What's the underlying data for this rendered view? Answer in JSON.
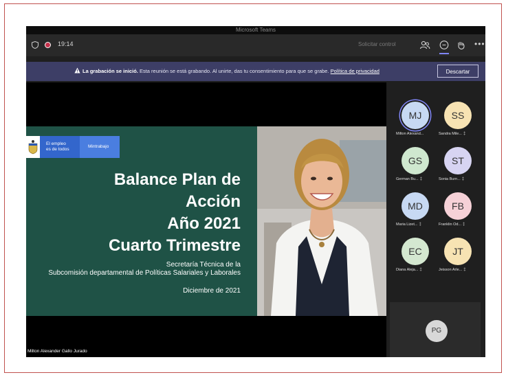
{
  "window": {
    "title": "Microsoft Teams"
  },
  "toolbar": {
    "time": "19:14",
    "request_control": "Solicitar control",
    "icons": [
      "shield-icon",
      "record-icon",
      "people-icon",
      "chat-icon",
      "reactions-icon",
      "more-icon"
    ],
    "more_label": "•••"
  },
  "banner": {
    "bold": "La grabación se inició.",
    "text": " Esta reunión se está grabando. Al unirte, das tu consentimiento para que se grabe. ",
    "link": "Política de privacidad",
    "dismiss": "Descartar"
  },
  "slide": {
    "logo_line1": "El empleo",
    "logo_line2": "es de todos",
    "logo_right": "Mintrabajo",
    "title_line1": "Balance Plan de",
    "title_line2": "Acción",
    "title_line3": "Año 2021",
    "title_line4": "Cuarto Trimestre",
    "sub_line1": "Secretaría Técnica de la",
    "sub_line2": "Subcomisión departamental de Políticas Salariales y Laborales",
    "date": "Diciembre de 2021"
  },
  "presenter": {
    "name": "Milton Alexander Gallo Jurado"
  },
  "participants": [
    {
      "initials": "MJ",
      "name": "Milton Alexand...",
      "color": "#c7d9f3",
      "active": true
    },
    {
      "initials": "SS",
      "name": "Sandra Mile...",
      "color": "#f7e3b3"
    },
    {
      "initials": "GS",
      "name": "German Bu...",
      "color": "#cfe8cf"
    },
    {
      "initials": "ST",
      "name": "Sonia Burn...",
      "color": "#d7d4f2"
    },
    {
      "initials": "MD",
      "name": "Maria Lizet...",
      "color": "#c7d9f3"
    },
    {
      "initials": "FB",
      "name": "Franklin Od...",
      "color": "#f6d1d7"
    },
    {
      "initials": "EC",
      "name": "Diana Aleja...",
      "color": "#d4e8d0"
    },
    {
      "initials": "JT",
      "name": "Jeisson Arle...",
      "color": "#f7e3b3"
    }
  ],
  "extra_participant": {
    "initials": "PG"
  }
}
